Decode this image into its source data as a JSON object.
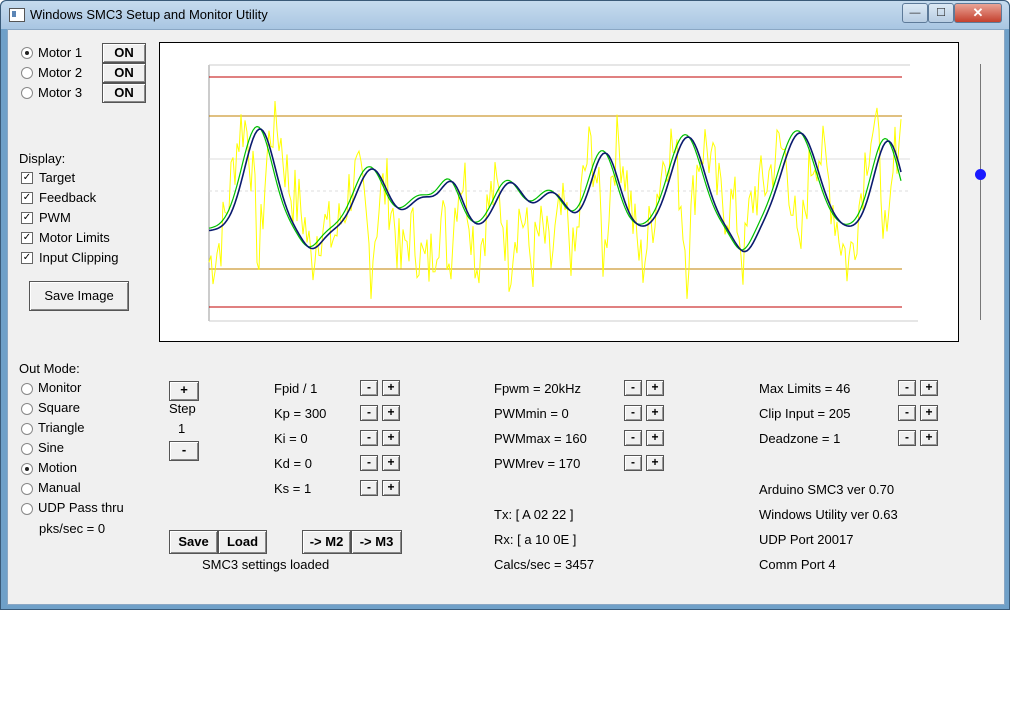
{
  "window": {
    "title": "Windows SMC3 Setup and Monitor Utility",
    "min": "—",
    "max": "☐",
    "close": "✕"
  },
  "motors": [
    {
      "label": "Motor 1",
      "button": "ON",
      "selected": true
    },
    {
      "label": "Motor 2",
      "button": "ON",
      "selected": false
    },
    {
      "label": "Motor 3",
      "button": "ON",
      "selected": false
    }
  ],
  "display": {
    "heading": "Display:",
    "items": [
      {
        "label": "Target",
        "checked": true
      },
      {
        "label": "Feedback",
        "checked": true
      },
      {
        "label": "PWM",
        "checked": true
      },
      {
        "label": "Motor Limits",
        "checked": true
      },
      {
        "label": "Input Clipping",
        "checked": true
      }
    ],
    "save_image": "Save Image"
  },
  "out_mode": {
    "heading": "Out Mode:",
    "items": [
      {
        "label": "Monitor",
        "selected": false
      },
      {
        "label": "Square",
        "selected": false
      },
      {
        "label": "Triangle",
        "selected": false
      },
      {
        "label": "Sine",
        "selected": false
      },
      {
        "label": "Motion",
        "selected": true
      },
      {
        "label": "Manual",
        "selected": false
      },
      {
        "label": "UDP Pass thru",
        "selected": false
      }
    ],
    "pks": "pks/sec = 0"
  },
  "step": {
    "plus": "+",
    "label": "Step",
    "value": "1",
    "minus": "-"
  },
  "pid": [
    "Fpid / 1",
    "Kp = 300",
    "Ki = 0",
    "Kd = 0",
    "Ks = 1"
  ],
  "pwm": [
    "Fpwm = 20kHz",
    "PWMmin = 0",
    "PWMmax = 160",
    "PWMrev = 170"
  ],
  "limits": [
    "Max Limits = 46",
    "Clip Input = 205",
    "Deadzone = 1"
  ],
  "info": [
    "Arduino SMC3 ver 0.70",
    "Windows Utility ver 0.63",
    "UDP Port 20017",
    "Comm Port 4"
  ],
  "comm": {
    "tx": "Tx: [ A 02 22 ]",
    "rx": "Rx: [ a 10 0E ]",
    "calcs": "Calcs/sec = 3457"
  },
  "buttons": {
    "save": "Save",
    "load": "Load",
    "to_m2": "-> M2",
    "to_m3": "-> M3",
    "minus": "-",
    "plus": "+"
  },
  "status": "SMC3 settings loaded",
  "colors": {
    "target": "#0a1a6e",
    "feedback": "#00c000",
    "pwm": "#ffff00",
    "limit": "#c00000",
    "clip": "#c08000"
  }
}
